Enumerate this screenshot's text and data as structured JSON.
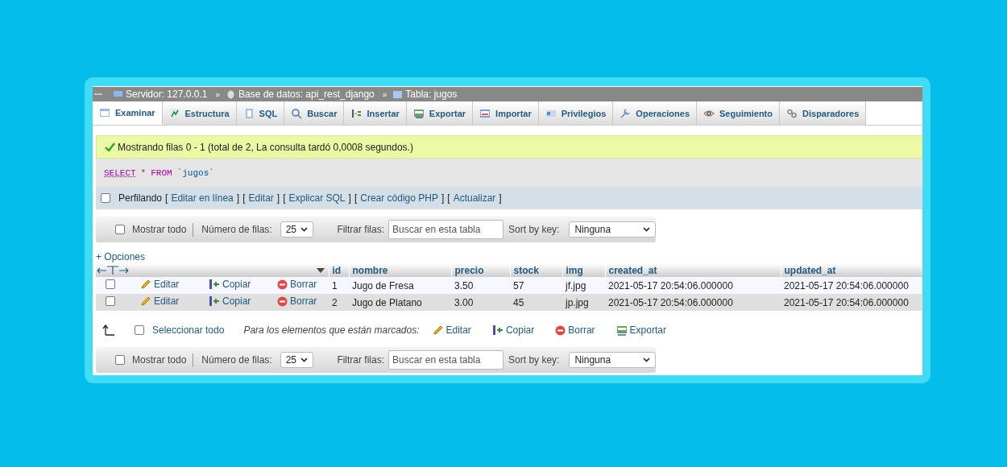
{
  "breadcrumb": [
    {
      "label": "Servidor: 127.0.0.1"
    },
    {
      "label": "Base de datos: api_rest_django"
    },
    {
      "label": "Tabla: jugos"
    }
  ],
  "breadcrumb_separator": "»",
  "tabs": [
    {
      "label": "Examinar",
      "selected": true
    },
    {
      "label": "Estructura",
      "selected": false
    },
    {
      "label": "SQL",
      "selected": false
    },
    {
      "label": "Buscar",
      "selected": false
    },
    {
      "label": "Insertar",
      "selected": false
    },
    {
      "label": "Exportar",
      "selected": false
    },
    {
      "label": "Importar",
      "selected": false
    },
    {
      "label": "Privilegios",
      "selected": false
    },
    {
      "label": "Operaciones",
      "selected": false
    },
    {
      "label": "Seguimiento",
      "selected": false
    },
    {
      "label": "Disparadores",
      "selected": false
    }
  ],
  "message": "Mostrando filas 0 - 1 (total de 2, La consulta tardó 0,0008 segundos.)",
  "sql": [
    {
      "kind": "keyword",
      "text": "SELECT"
    },
    {
      "kind": "operator",
      "text": "*"
    },
    {
      "kind": "operator",
      "text": "FROM"
    },
    {
      "kind": "name",
      "text": "`jugos`"
    }
  ],
  "profiling": {
    "label": "Perfilando",
    "checked": false,
    "bracket_open": "[",
    "bracket_close": "]",
    "links": [
      "Editar en línea",
      "Editar",
      "Explicar SQL",
      "Crear código PHP",
      "Actualizar"
    ]
  },
  "navigation_top": {
    "show_all": {
      "label": "Mostrar todo",
      "checked": false
    },
    "rows_label": "Número de filas:",
    "rows_value": "25",
    "filter_label": "Filtrar filas:",
    "filter_placeholder": "Buscar en esta tabla",
    "sort_label": "Sort by key:",
    "sort_value": "Ninguna"
  },
  "options_link": "+ Opciones",
  "table": {
    "columns": [
      "id",
      "nombre",
      "precio",
      "stock",
      "img",
      "created_at",
      "updated_at"
    ],
    "rows": [
      {
        "selected": false,
        "actions": [
          "Editar",
          "Copiar",
          "Borrar"
        ],
        "cells": [
          "1",
          "Jugo de Fresa",
          "3.50",
          "57",
          "jf.jpg",
          "2021-05-17 20:54:06.000000",
          "2021-05-17 20:54:06.000000"
        ]
      },
      {
        "selected": false,
        "actions": [
          "Editar",
          "Copiar",
          "Borrar"
        ],
        "cells": [
          "2",
          "Jugo de Platano",
          "3.00",
          "45",
          "jp.jpg",
          "2021-05-17 20:54:06.000000",
          "2021-05-17 20:54:06.000000"
        ]
      }
    ]
  },
  "bulk": {
    "select_all": {
      "label": "Seleccionar todo",
      "checked": false
    },
    "prompt": "Para los elementos que están marcados:",
    "actions": [
      "Editar",
      "Copiar",
      "Borrar",
      "Exportar"
    ]
  },
  "navigation_bottom": {
    "show_all": {
      "label": "Mostrar todo",
      "checked": false
    },
    "rows_label": "Número de filas:",
    "rows_value": "25",
    "filter_label": "Filtrar filas:",
    "filter_placeholder": "Buscar en esta tabla",
    "sort_label": "Sort by key:",
    "sort_value": "Ninguna"
  }
}
